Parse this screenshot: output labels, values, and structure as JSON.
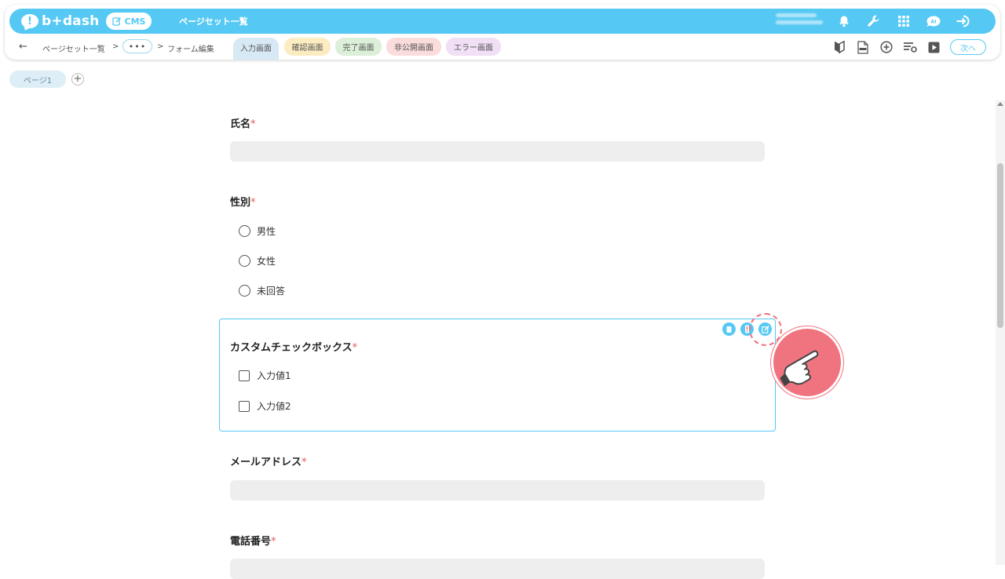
{
  "header": {
    "logo_text": "b+dash",
    "cms_label": "CMS",
    "title": "ページセット一覧"
  },
  "breadcrumb": {
    "back": "←",
    "item1": "ページセット一覧",
    "sep1": ">",
    "ellipsis": "•••",
    "sep2": ">",
    "item2": "フォーム編集"
  },
  "screen_tabs": [
    {
      "label": "入力画面",
      "color": "#d7e9f4"
    },
    {
      "label": "確認画面",
      "color": "#fbecc2"
    },
    {
      "label": "完了画面",
      "color": "#dcefd8"
    },
    {
      "label": "非公開画面",
      "color": "#fadcdc"
    },
    {
      "label": "エラー画面",
      "color": "#f0dff5"
    }
  ],
  "toolbar_icons": [
    "beginner-mark-icon",
    "html-file-icon",
    "add-circle-icon",
    "settings-list-icon",
    "play-icon"
  ],
  "next_label": "次へ",
  "top_icons": [
    "bell-icon",
    "wrench-icon",
    "grid-icon",
    "ai-icon",
    "logout-icon"
  ],
  "page_tabs": {
    "page1": "ページ1",
    "add": "+"
  },
  "form": {
    "name": {
      "label": "氏名",
      "required": "*"
    },
    "gender": {
      "label": "性別",
      "required": "*",
      "options": [
        "男性",
        "女性",
        "未回答"
      ]
    },
    "custom_checkbox": {
      "label": "カスタムチェックボックス",
      "required": "*",
      "options": [
        "入力値1",
        "入力値2"
      ]
    },
    "email": {
      "label": "メールアドレス",
      "required": "*"
    },
    "phone": {
      "label": "電話番号",
      "required": "*"
    }
  },
  "colors": {
    "accent": "#55c9f3",
    "required": "#e05a5a",
    "pointer": "#f07480"
  }
}
